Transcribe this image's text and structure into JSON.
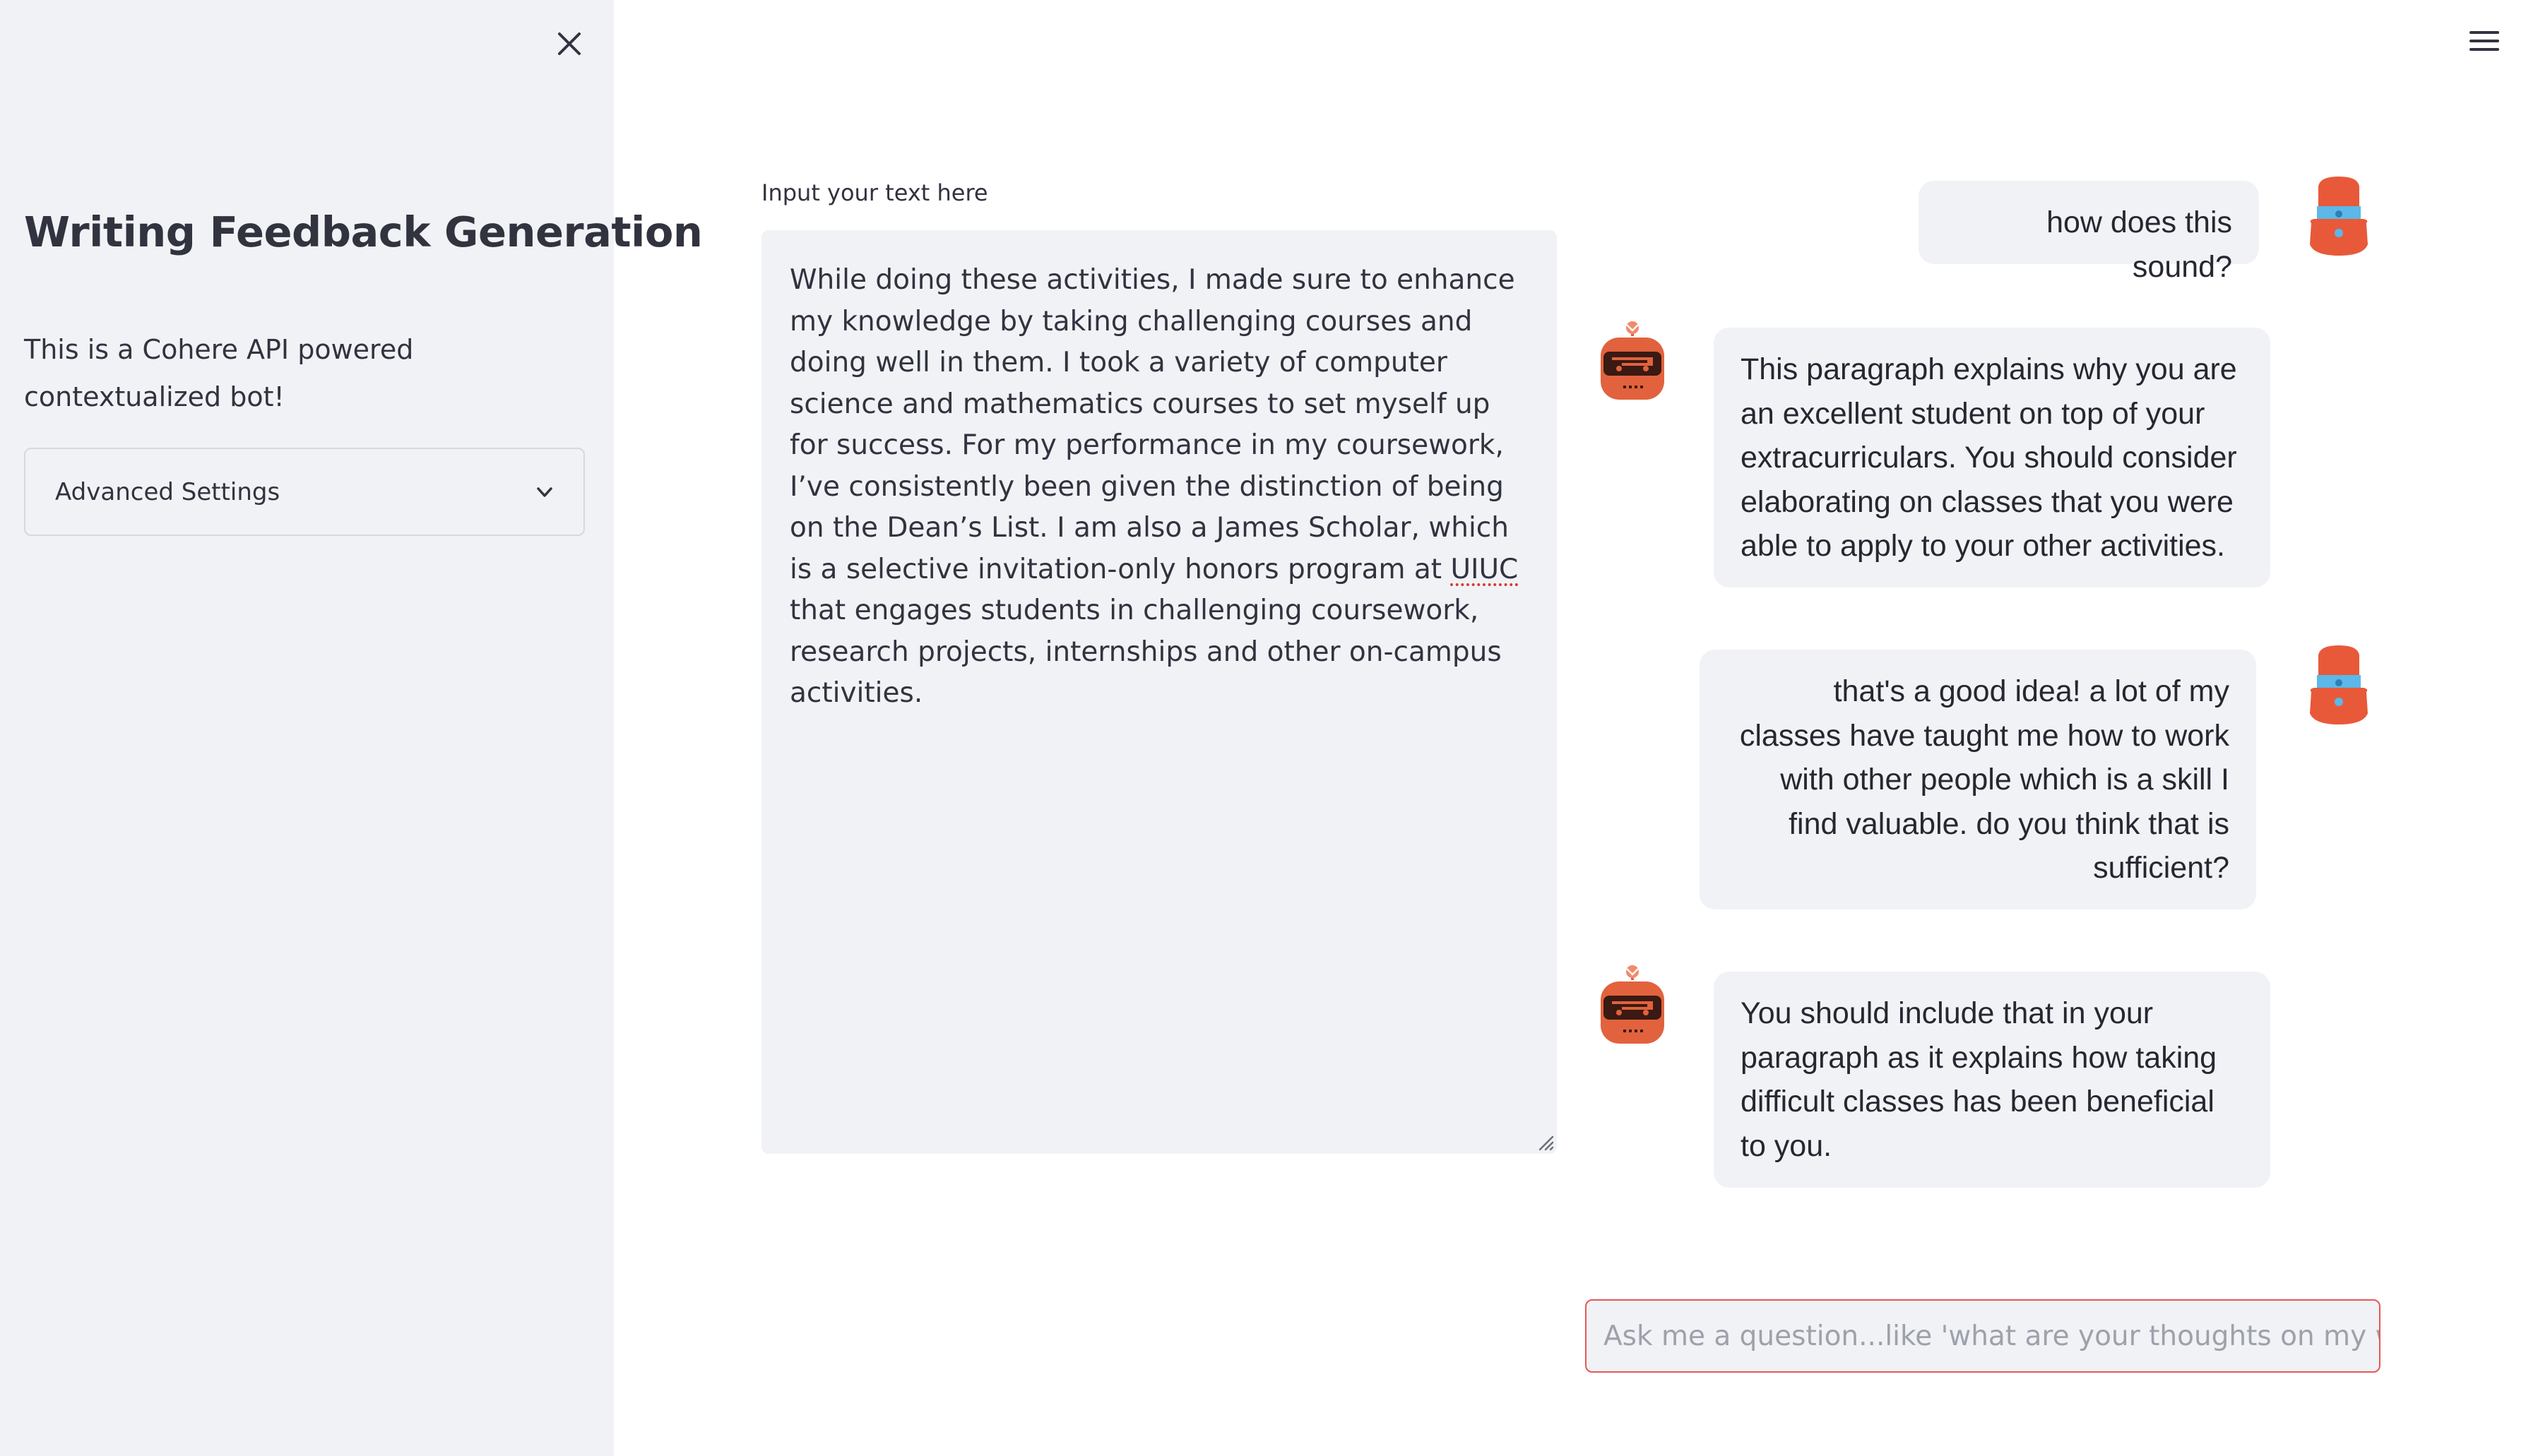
{
  "sidebar": {
    "close_icon": "close-icon",
    "title": "Writing Feedback Generation",
    "description": "This is a Cohere API powered contextualized bot!",
    "expander": {
      "label": "Advanced Settings",
      "icon": "chevron-down-icon"
    }
  },
  "header": {
    "menu_icon": "hamburger-menu-icon"
  },
  "editor": {
    "label": "Input your text here",
    "text_before": "While doing these activities, I made sure to enhance my knowledge by taking challenging courses and doing well in them. I took a variety of computer science and mathematics courses to set myself up for success. For my performance in my coursework, I’ve consistently been given the distinction of being on the Dean’s List. I am also a James Scholar, which is a selective invitation-only honors program at ",
    "text_flagged": "UIUC",
    "text_after": " that engages students in challenging coursework, research projects, internships and other on-campus activities."
  },
  "chat": {
    "messages": [
      {
        "role": "user",
        "text": "how does this sound?"
      },
      {
        "role": "bot",
        "text": "This paragraph explains why you are an excellent student on top of your extracurriculars. You should consider elaborating on classes that you were able to apply to your other activities."
      },
      {
        "role": "user",
        "text": "that's a good idea! a lot of my classes have taught me how to work with other people which is a skill I find valuable. do you think that is sufficient?"
      },
      {
        "role": "bot",
        "text": "You should include that in your paragraph as it explains how taking difficult classes has been beneficial to you."
      }
    ],
    "input": {
      "placeholder": "Ask me a question...like 'what are your thoughts on my writing",
      "value": ""
    }
  },
  "colors": {
    "sidebar_bg": "#f0f2f6",
    "bubble_bg": "#f0f2f6",
    "user_avatar": "#e8593a",
    "user_avatar_band": "#5bb8e8",
    "bot_avatar": "#e2623d",
    "input_focus_border": "#e45858"
  }
}
